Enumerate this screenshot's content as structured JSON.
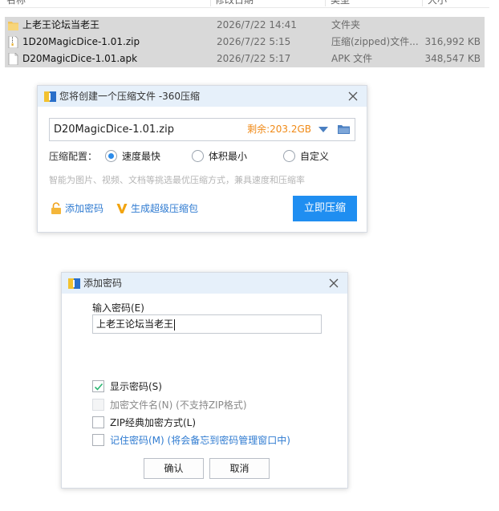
{
  "explorer": {
    "columns": [
      "名称",
      "修改日期",
      "类型",
      "大小"
    ],
    "files": [
      {
        "name": "上老王论坛当老王",
        "date": "2026/7/22 14:41",
        "type": "文件夹",
        "size": "",
        "icon": "folder-icon"
      },
      {
        "name": "1D20MagicDice-1.01.zip",
        "date": "2026/7/22 5:15",
        "type": "压缩(zipped)文件...",
        "size": "316,992 KB",
        "icon": "zip-file-icon"
      },
      {
        "name": "D20MagicDice-1.01.apk",
        "date": "2026/7/22 5:17",
        "type": "APK 文件",
        "size": "348,547 KB",
        "icon": "file-icon"
      }
    ]
  },
  "compress_dialog": {
    "title": "您将创建一个压缩文件 -360压缩",
    "filename": "D20MagicDice-1.01.zip",
    "remaining": "剩余:203.2GB",
    "config_label": "压缩配置：",
    "options": [
      {
        "label": "速度最快",
        "selected": true
      },
      {
        "label": "体积最小",
        "selected": false
      },
      {
        "label": "自定义",
        "selected": false
      }
    ],
    "hint": "智能为图片、视频、文档等挑选最优压缩方式，兼具速度和压缩率",
    "add_password": "添加密码",
    "super_compress": "生成超级压缩包",
    "compress_button": "立即压缩"
  },
  "password_dialog": {
    "title": "添加密码",
    "input_label": "输入密码(E)",
    "password_value": "上老王论坛当老王",
    "checkboxes": [
      {
        "label": "显示密码(S)",
        "checked": true,
        "disabled": false
      },
      {
        "label": "加密文件名(N) (不支持ZIP格式)",
        "checked": false,
        "disabled": true
      },
      {
        "label": "ZIP经典加密方式(L)",
        "checked": false,
        "disabled": false
      },
      {
        "label": "记住密码(M) (将会备忘到密码管理窗口中)",
        "checked": false,
        "disabled": false
      }
    ],
    "ok_button": "确认",
    "cancel_button": "取消"
  },
  "colors": {
    "accent": "#1f8ef1",
    "link": "#2f7bd1",
    "remaining": "#f08a17",
    "title_bar": "#e6f0fa",
    "selected_row": "#d9d9d9",
    "check": "#2bb673"
  }
}
